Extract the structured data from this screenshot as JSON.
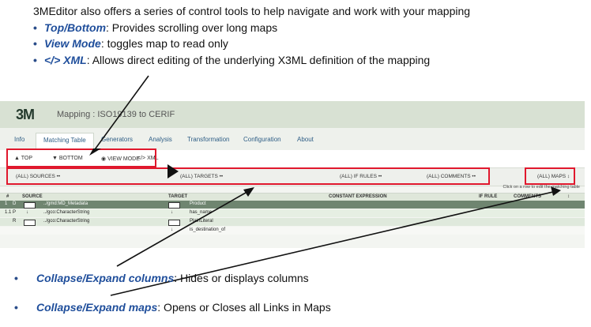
{
  "intro": "3MEditor also offers a series of control tools to help navigate and work with your mapping",
  "bullets": [
    {
      "term": "Top/Bottom",
      "desc": ": Provides scrolling over long maps"
    },
    {
      "term": "View Mode",
      "desc": ": toggles map to read only"
    },
    {
      "term": "</> XML",
      "desc": ": Allows direct editing of the underlying X3ML definition of the mapping"
    }
  ],
  "bottom_bullets": [
    {
      "term": "Collapse/Expand columns",
      "desc": ": Hides or displays columns"
    },
    {
      "term": "Collapse/Expand maps",
      "desc": ": Opens or Closes all Links in Maps"
    }
  ],
  "app": {
    "logo": "3M",
    "title": "Mapping : ISO19139 to CERIF",
    "tabs": [
      "Info",
      "Matching Table",
      "Generators",
      "Analysis",
      "Transformation",
      "Configuration",
      "About"
    ],
    "toolbar": {
      "top": "TOP",
      "bottom": "BOTTOM",
      "view_mode": "VIEW MODE",
      "xml_icon": "</>",
      "xml": "XML"
    },
    "filters": {
      "sources": "(ALL) SOURCES ••",
      "targets": "(ALL) TARGETS ••",
      "if_rules": "(ALL) IF RULES ••",
      "comments": "(ALL) COMMENTS ••",
      "maps": "(ALL) MAPS ↕"
    },
    "hint": "Click on a row to edit the matching table",
    "columns": [
      "#",
      "SOURCE",
      "TARGET",
      "CONSTANT EXPRESSION",
      "IF RULE",
      "COMMENTS",
      "↕"
    ],
    "rows": [
      {
        "num": "1",
        "type": "D",
        "source": "../gmd:MD_Metadata",
        "target": "Product"
      },
      {
        "num": "1.1",
        "type": "P",
        "source": "../gco:CharacterString",
        "target": "has_name"
      },
      {
        "num": "",
        "type": "R",
        "source": "../gco:CharacterString",
        "target": "PlainLiteral"
      },
      {
        "num": "",
        "type": "",
        "source": "",
        "target": "is_destination_of"
      }
    ]
  },
  "colors": {
    "highlight": "#e0182d",
    "term": "#1f4e9b",
    "header_bar": "#d8e1d3"
  }
}
